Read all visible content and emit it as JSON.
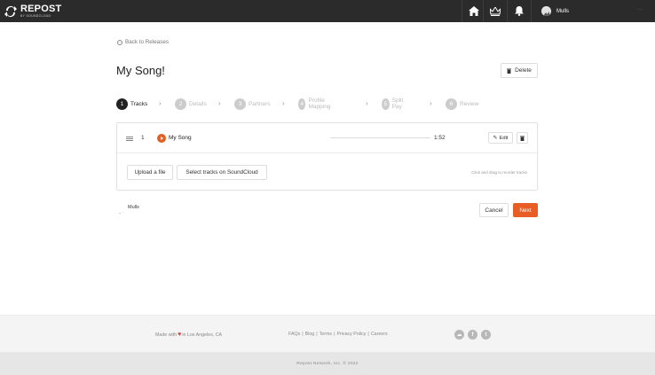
{
  "brand": {
    "name": "REPOST",
    "sub": "BY SOUNDCLOUD"
  },
  "nav": {
    "icons": [
      "home-icon",
      "crown-icon",
      "bell-icon"
    ]
  },
  "user": {
    "name": "Mulls",
    "more": "···"
  },
  "back": {
    "label": "Back to Releases"
  },
  "page": {
    "title": "My Song!"
  },
  "actions": {
    "delete_label": "Delete",
    "cancel_label": "Cancel",
    "next_label": "Next"
  },
  "steps": [
    {
      "num": "1",
      "label": "Tracks"
    },
    {
      "num": "2",
      "label": "Details"
    },
    {
      "num": "3",
      "label": "Partners"
    },
    {
      "num": "4",
      "label": "Profile Mapping"
    },
    {
      "num": "5",
      "label": "Split Pay"
    },
    {
      "num": "6",
      "label": "Review"
    }
  ],
  "tracks": [
    {
      "index": "1",
      "title": "My Song",
      "duration": "1:52",
      "edit_label": "Edit"
    }
  ],
  "upload": {
    "upload_label": "Upload a file",
    "select_label": "Select tracks on SoundCloud",
    "hint": "Click and drag to reorder tracks"
  },
  "owner": {
    "name": "Mulls"
  },
  "footer": {
    "made_with_prefix": "Made with",
    "made_with_suffix": "in Los Angeles, CA",
    "links": [
      "FAQs",
      "Blog",
      "Terms",
      "Privacy Policy",
      "Careers"
    ],
    "social": [
      "soundcloud-icon",
      "facebook-icon",
      "twitter-icon"
    ],
    "copyright": "Repost Network, Inc. © 2022"
  },
  "colors": {
    "accent": "#e85c25",
    "topbar": "#2b2b2b",
    "active_step": "#222222",
    "inactive_step": "#cccccc"
  }
}
